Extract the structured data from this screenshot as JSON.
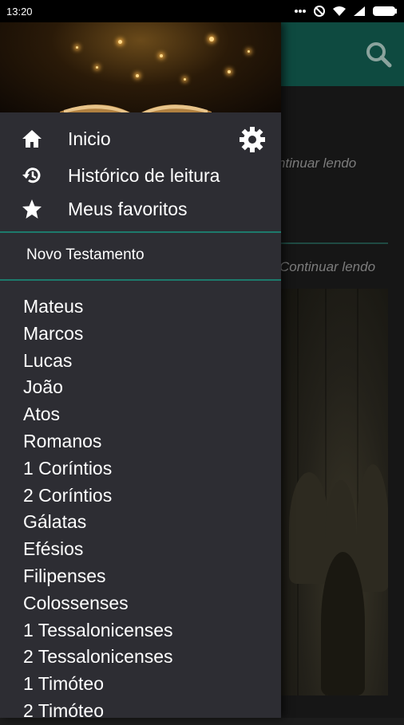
{
  "status_bar": {
    "time": "13:20"
  },
  "drawer": {
    "menu": [
      {
        "label": "Inicio",
        "icon": "home-icon"
      },
      {
        "label": "Histórico de leitura",
        "icon": "history-icon"
      },
      {
        "label": "Meus favoritos",
        "icon": "star-icon"
      }
    ],
    "section_title": "Novo Testamento",
    "books": [
      "Mateus",
      "Marcos",
      "Lucas",
      "João",
      "Atos",
      "Romanos",
      "1 Coríntios",
      "2 Coríntios",
      "Gálatas",
      "Efésios",
      "Filipenses",
      "Colossenses",
      "1 Tessalonicenses",
      "2 Tessalonicenses",
      "1 Timóteo",
      "2 Timóteo"
    ]
  },
  "background": {
    "continue_1": "continuar lendo",
    "continue_2": "Continuar lendo"
  },
  "colors": {
    "accent": "#1d7a6c",
    "appbar": "#0e4a40",
    "drawer_bg": "#2d2d33"
  }
}
